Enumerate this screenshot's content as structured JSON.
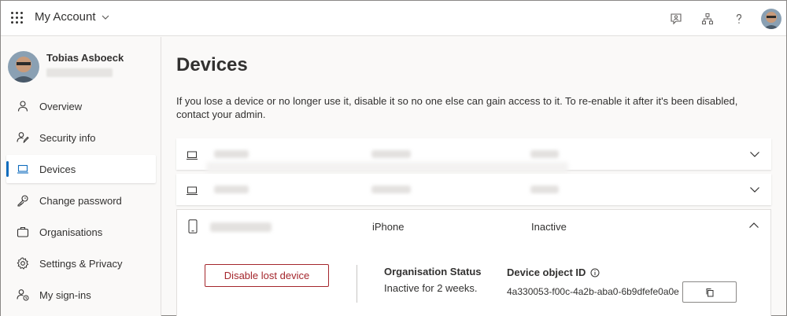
{
  "header": {
    "app_title": "My Account",
    "icons": [
      "feedback-icon",
      "organization-icon",
      "help-icon",
      "avatar"
    ]
  },
  "profile": {
    "name": "Tobias Asboeck"
  },
  "sidebar": {
    "items": [
      {
        "label": "Overview",
        "icon": "person-icon"
      },
      {
        "label": "Security info",
        "icon": "security-info-icon"
      },
      {
        "label": "Devices",
        "icon": "laptop-icon",
        "active": true
      },
      {
        "label": "Change password",
        "icon": "key-icon"
      },
      {
        "label": "Organisations",
        "icon": "briefcase-icon"
      },
      {
        "label": "Settings & Privacy",
        "icon": "gear-icon"
      },
      {
        "label": "My sign-ins",
        "icon": "sign-ins-icon"
      }
    ]
  },
  "main": {
    "title": "Devices",
    "description": "If you lose a device or no longer use it, disable it so no one else can gain access to it. To re-enable it after it's been disabled, contact your admin.",
    "devices": [
      {
        "type": "laptop",
        "expanded": false
      },
      {
        "type": "laptop",
        "expanded": false
      },
      {
        "type": "phone",
        "expanded": true,
        "model": "iPhone",
        "status": "Inactive",
        "disable_label": "Disable lost device",
        "org_status_label": "Organisation Status",
        "org_status_value": "Inactive for 2 weeks.",
        "object_id_label": "Device object ID",
        "object_id_value": "4a330053-f00c-4a2b-aba0-6b9dfefe0a0e"
      }
    ]
  },
  "colors": {
    "accent": "#0f6cbd",
    "danger": "#a4262c",
    "background": "#faf9f8"
  }
}
